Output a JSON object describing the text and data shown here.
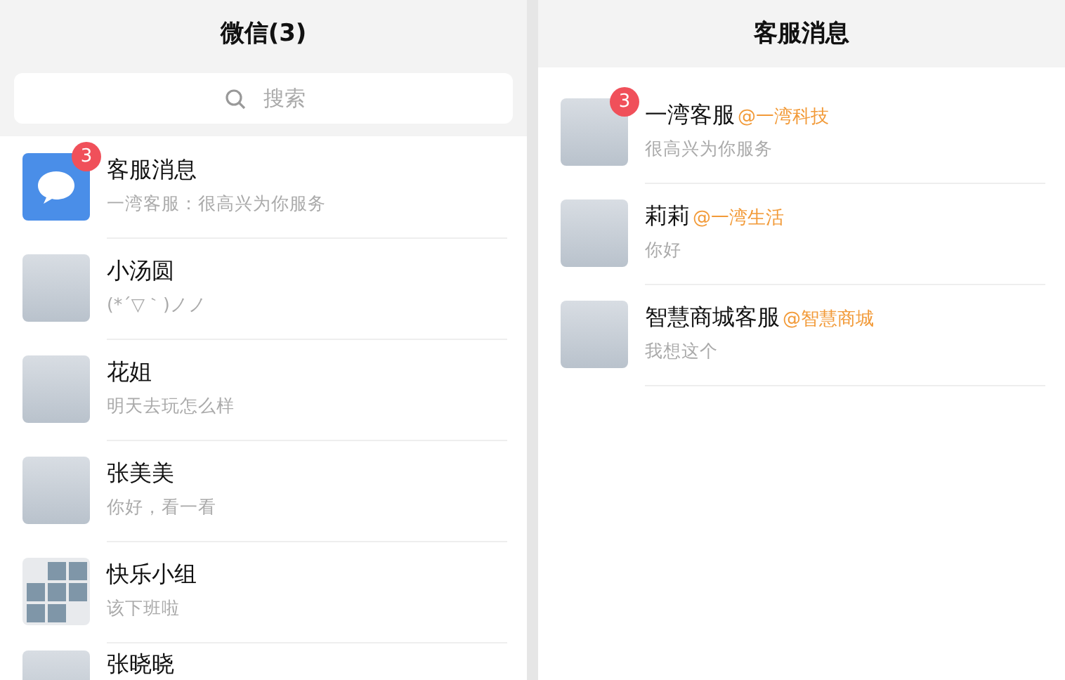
{
  "left": {
    "title": "微信(3)",
    "search": {
      "placeholder": "搜索"
    },
    "chats": [
      {
        "kind": "service",
        "name": "客服消息",
        "preview": "一湾客服：很高兴为你服务",
        "badge": "3"
      },
      {
        "kind": "photo",
        "name": "小汤圆",
        "preview": "(*´▽｀)ノノ"
      },
      {
        "kind": "photo",
        "name": "花姐",
        "preview": "明天去玩怎么样"
      },
      {
        "kind": "photo",
        "name": "张美美",
        "preview": "你好，看一看"
      },
      {
        "kind": "group",
        "name": "快乐小组",
        "preview": "该下班啦"
      },
      {
        "kind": "photo",
        "name": "张晓晓"
      }
    ]
  },
  "right": {
    "title": "客服消息",
    "messages": [
      {
        "name": "一湾客服",
        "org": "@一湾科技",
        "preview": "很高兴为你服务",
        "badge": "3"
      },
      {
        "name": "莉莉",
        "org": "@一湾生活",
        "preview": "你好"
      },
      {
        "name": "智慧商城客服",
        "org": "@智慧商城",
        "preview": "我想这个"
      }
    ]
  }
}
